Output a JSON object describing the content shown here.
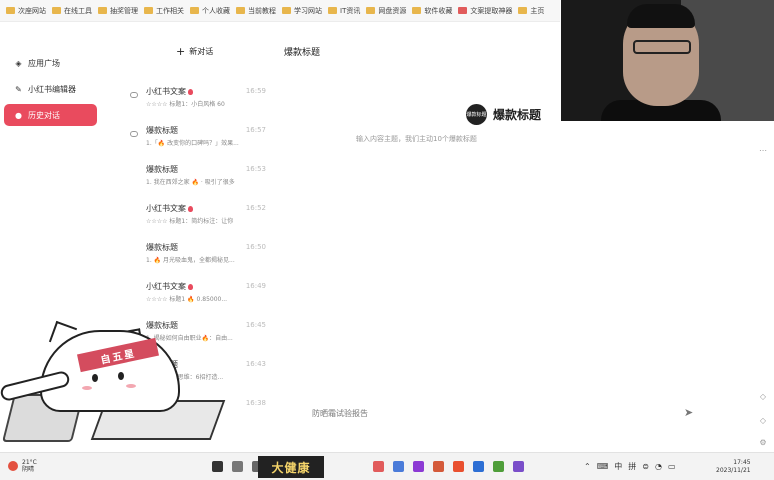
{
  "bookmarks": [
    {
      "label": "次座网站",
      "color": "#e8b64c"
    },
    {
      "label": "在线工具",
      "color": "#e8b64c"
    },
    {
      "label": "抽奖管理",
      "color": "#e8b64c"
    },
    {
      "label": "工作相关",
      "color": "#e8b64c"
    },
    {
      "label": "个人收藏",
      "color": "#e8b64c"
    },
    {
      "label": "当前教程",
      "color": "#e8b64c"
    },
    {
      "label": "学习网站",
      "color": "#e8b64c"
    },
    {
      "label": "IT资讯",
      "color": "#e8b64c"
    },
    {
      "label": "网盘资源",
      "color": "#e8b64c"
    },
    {
      "label": "软件收藏",
      "color": "#e8b64c"
    },
    {
      "label": "文案提取神器",
      "color": "#e15b5b"
    },
    {
      "label": "主页",
      "color": "#e8b64c"
    }
  ],
  "nav": {
    "items": [
      {
        "label": "应用广场",
        "icon": "◈"
      },
      {
        "label": "小红书编辑器",
        "icon": "✎"
      },
      {
        "label": "历史对话",
        "icon": "●"
      }
    ]
  },
  "conversations": {
    "new_label": "新对话",
    "items": [
      {
        "title": "小红书文案",
        "flame": true,
        "time": "16:59",
        "preview": "☆☆☆☆ 标题1：小白风格 60"
      },
      {
        "title": "爆款标题",
        "flame": false,
        "time": "16:57",
        "preview": "1.「🔥 改变你的口碑吗？」效果..."
      },
      {
        "title": "爆款标题",
        "flame": false,
        "time": "16:53",
        "preview": "1. 我在西郊之家 🔥 · 吸引了很多"
      },
      {
        "title": "小红书文案",
        "flame": true,
        "time": "16:52",
        "preview": "☆☆☆☆ 标题1：简约标注：让你"
      },
      {
        "title": "爆款标题",
        "flame": false,
        "time": "16:50",
        "preview": "1. 🔥 月光吸血鬼，全都揭秘见..."
      },
      {
        "title": "小红书文案",
        "flame": true,
        "time": "16:49",
        "preview": "☆☆☆☆ 标题1 🔥 0.85000..."
      },
      {
        "title": "爆款标题",
        "flame": false,
        "time": "16:45",
        "preview": "1. 揭秘如何自由职业🔥：自由..."
      },
      {
        "title": "爆款标题",
        "flame": false,
        "time": "16:43",
        "preview": "1. 如何破除思维：6招打造..."
      },
      {
        "title": "爆款标题",
        "flame": false,
        "time": "16:38",
        "preview": ""
      }
    ]
  },
  "main": {
    "title": "爆款标题",
    "brand_logo": "爆款标题",
    "brand_name": "爆款标题",
    "brand_sub": "输入内容主题，我们主动10个爆款标题",
    "input_placeholder": "防晒霜试验报告",
    "send_icon": "send-icon"
  },
  "mascot": {
    "band_text": "自五星"
  },
  "taskbar": {
    "weather_temp": "21°C",
    "weather_desc": "阴晴",
    "sticker_text": "大健康",
    "tray_items": [
      "⌃",
      "⌨",
      "中",
      "拼",
      "⊜",
      "◔",
      "▭"
    ],
    "time": "17:45",
    "date": "2023/11/21",
    "task_icon_colors": [
      "#333333",
      "#777777",
      "#666666",
      "#e15b5b",
      "#4a7bd9",
      "#8c3ad4",
      "#d45a3a",
      "#e9502f",
      "#2d6fd4",
      "#4f9e3a",
      "#7a4ec9"
    ]
  }
}
